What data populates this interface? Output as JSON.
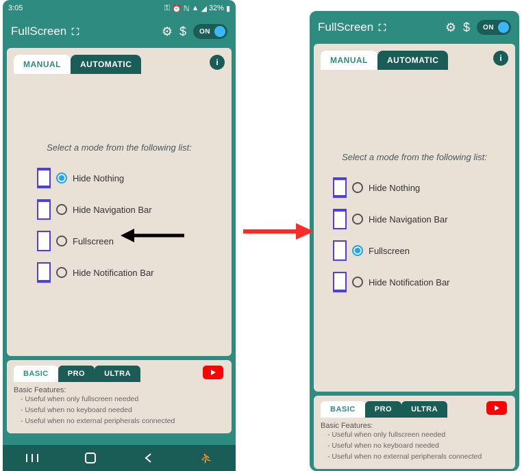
{
  "statusbar": {
    "time": "3:05",
    "battery": "32%"
  },
  "appbar": {
    "title": "FullScreen",
    "gear": "⚙",
    "dollar": "$",
    "toggle_label": "ON"
  },
  "tabs": {
    "manual": "MANUAL",
    "automatic": "AUTOMATIC"
  },
  "mode_title": "Select a mode from the following list:",
  "modes": [
    {
      "label": "Hide Nothing"
    },
    {
      "label": "Hide Navigation Bar"
    },
    {
      "label": "Fullscreen"
    },
    {
      "label": "Hide Notification Bar"
    }
  ],
  "left_selected_index": 0,
  "right_selected_index": 2,
  "footer_tabs": {
    "basic": "BASIC",
    "pro": "PRO",
    "ultra": "ULTRA"
  },
  "features": {
    "title": "Basic Features:",
    "items": [
      "Useful when only fullscreen needed",
      "Useful when no keyboard needed",
      "Useful when no external peripherals connected"
    ]
  },
  "info_char": "i"
}
